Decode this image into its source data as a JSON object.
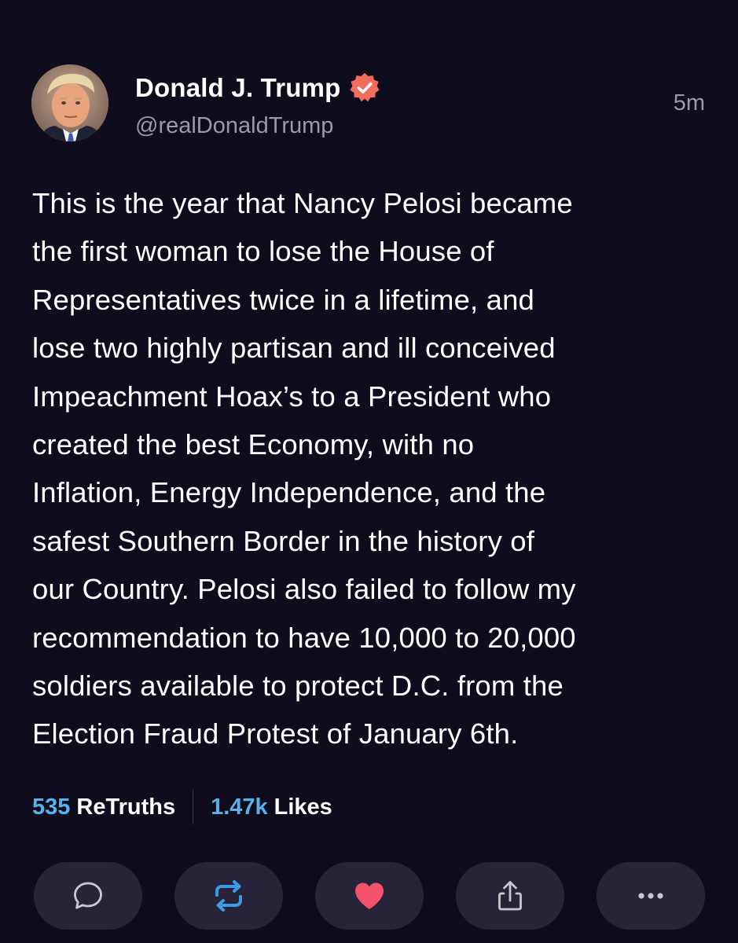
{
  "post": {
    "author": {
      "display_name": "Donald J. Trump",
      "handle": "@realDonaldTrump",
      "verified": true,
      "verified_badge_color": "#f26d5b"
    },
    "timestamp": "5m",
    "text": "This is the year that Nancy Pelosi became\nthe first woman to lose the House of\nRepresentatives twice in a lifetime, and\nlose two highly partisan and ill conceived\nImpeachment Hoax’s to a President who\ncreated the best Economy, with no\nInflation, Energy Independence, and the\nsafest Southern Border in the history of\nour Country. Pelosi also failed to follow my\nrecommendation to have 10,000 to 20,000\nsoldiers available to protect D.C. from the\nElection Fraud Protest of January 6th.",
    "stats": {
      "retruths_count": "535",
      "retruths_label": "ReTruths",
      "likes_count": "1.47k",
      "likes_label": "Likes"
    },
    "actions": [
      {
        "icon": "reply-icon"
      },
      {
        "icon": "retruth-icon"
      },
      {
        "icon": "heart-icon"
      },
      {
        "icon": "share-icon"
      },
      {
        "icon": "more-icon"
      }
    ]
  },
  "colors": {
    "background": "#0e0c1d",
    "accent_blue": "#5ab1ea",
    "retruth_icon": "#3c9be5",
    "heart": "#f4516b",
    "button_bg": "#272439",
    "secondary_text": "#9b9aa8"
  }
}
